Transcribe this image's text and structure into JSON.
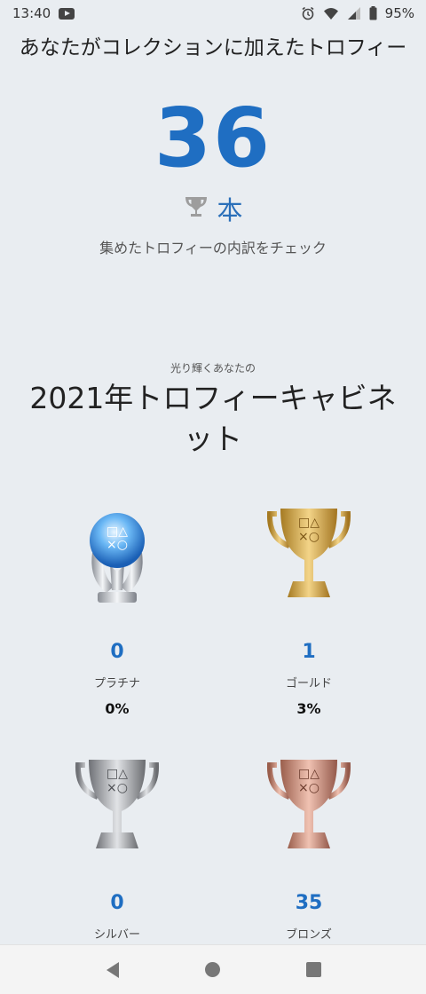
{
  "status_bar": {
    "time": "13:40",
    "battery": "95%",
    "icons": [
      "youtube-icon",
      "alarm-icon",
      "wifi-icon",
      "signal-icon",
      "battery-icon"
    ]
  },
  "summary": {
    "headline": "あなたがコレクションに加えたトロフィー",
    "count": "36",
    "unit": "本",
    "check_link": "集めたトロフィーの内訳をチェック"
  },
  "cabinet": {
    "subtitle": "光り輝くあなたの",
    "title": "2021年トロフィーキャビネット"
  },
  "trophies": [
    {
      "type": "platinum",
      "count": "0",
      "name": "プラチナ",
      "percent": "0%"
    },
    {
      "type": "gold",
      "count": "1",
      "name": "ゴールド",
      "percent": "3%"
    },
    {
      "type": "silver",
      "count": "0",
      "name": "シルバー"
    },
    {
      "type": "bronze",
      "count": "35",
      "name": "ブロンズ"
    }
  ],
  "colors": {
    "background": "#e9edf1",
    "accent": "#1f6ec2",
    "platinum": "#4a9ee8",
    "gold": "#d9a83a",
    "silver": "#9a9a9a",
    "bronze": "#c98a76"
  },
  "nav": {
    "icons": [
      "back-icon",
      "home-icon",
      "recents-icon"
    ]
  }
}
